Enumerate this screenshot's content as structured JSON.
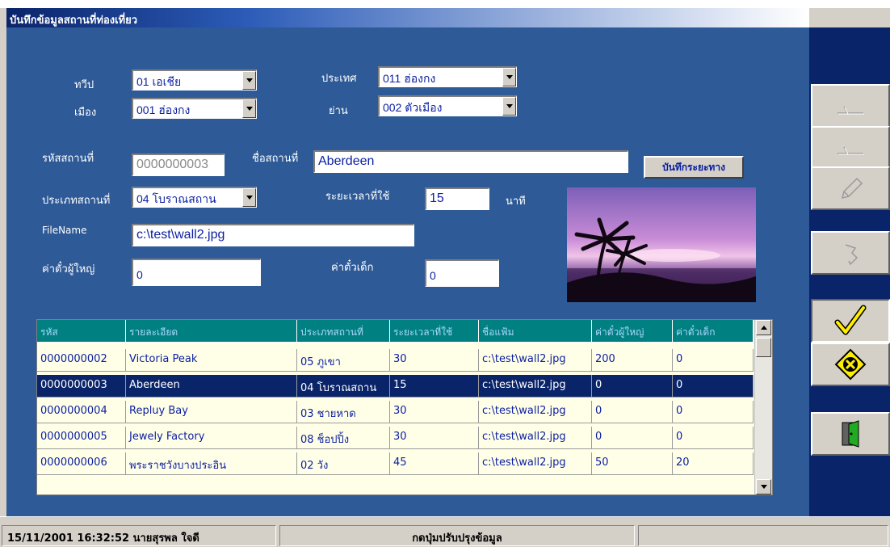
{
  "window": {
    "title": "บันทึกข้อมูลสถานที่ท่องเที่ยว"
  },
  "form": {
    "continent_label": "ทวีป",
    "continent_value": "01 เอเชีย",
    "country_label": "ประเทศ",
    "country_value": "011 ฮ่องกง",
    "city_label": "เมือง",
    "city_value": "001 ฮ่องกง",
    "district_label": "ย่าน",
    "district_value": "002 ตัวเมือง",
    "place_code_label": "รหัสสถานที่",
    "place_code_value": "0000000003",
    "place_name_label": "ชื่อสถานที่",
    "place_name_value": "Aberdeen",
    "save_distance_button": "บันทึกระยะทาง",
    "place_type_label": "ประเภทสถานที่",
    "place_type_value": "04 โบราณสถาน",
    "duration_label": "ระยะเวลาที่ใช้",
    "duration_value": "15",
    "duration_unit": "นาที",
    "filename_label": "FileName",
    "filename_value": "c:\\test\\wall2.jpg",
    "adult_fee_label": "ค่าตั๋วผู้ใหญ่",
    "adult_fee_value": "0",
    "child_fee_label": "ค่าตั๋วเด็ก",
    "child_fee_value": "0"
  },
  "grid": {
    "headers": [
      "รหัส",
      "รายละเอียด",
      "ประเภทสถานที่",
      "ระยะเวลาที่ใช้",
      "ชื่อแฟ้ม",
      "ค่าตั๋วผู้ใหญ่",
      "ค่าตั๋วเด็ก"
    ],
    "rows": [
      [
        "0000000002",
        "Victoria Peak",
        "05 ภูเขา",
        "30",
        "c:\\test\\wall2.jpg",
        "200",
        "0"
      ],
      [
        "0000000003",
        "Aberdeen",
        "04 โบราณสถาน",
        "15",
        "c:\\test\\wall2.jpg",
        "0",
        "0"
      ],
      [
        "0000000004",
        "Repluy Bay",
        "03 ชายหาด",
        "30",
        "c:\\test\\wall2.jpg",
        "0",
        "0"
      ],
      [
        "0000000005",
        "Jewely Factory",
        "08 ช็อปปิ้ง",
        "30",
        "c:\\test\\wall2.jpg",
        "0",
        "0"
      ],
      [
        "0000000006",
        "พระราชวังบางประอิน",
        "02 วัง",
        "45",
        "c:\\test\\wall2.jpg",
        "50",
        "20"
      ]
    ],
    "selected_row": 1
  },
  "toolbar": {
    "buttons": [
      {
        "icon": "first-record-icon",
        "enabled": false
      },
      {
        "icon": "prev-record-icon",
        "enabled": false
      },
      {
        "icon": "edit-pencil-icon",
        "enabled": false
      },
      {
        "icon": "undo-icon",
        "enabled": false
      },
      {
        "icon": "checkmark-icon",
        "enabled": true
      },
      {
        "icon": "cancel-x-icon",
        "enabled": true
      },
      {
        "icon": "exit-door-icon",
        "enabled": true
      }
    ]
  },
  "statusbar": {
    "datetime_user": "15/11/2001 16:32:52 นายสุรพล ใจดี",
    "message": "กดปุ่มปรับปรุงข้อมูล",
    "extra": ""
  },
  "colors": {
    "form_bg": "#2e5a97",
    "toolbar_bg": "#0a246a",
    "grid_header_bg": "#008080",
    "grid_row_bg": "#ffffe8",
    "selection_bg": "#0a246a"
  }
}
